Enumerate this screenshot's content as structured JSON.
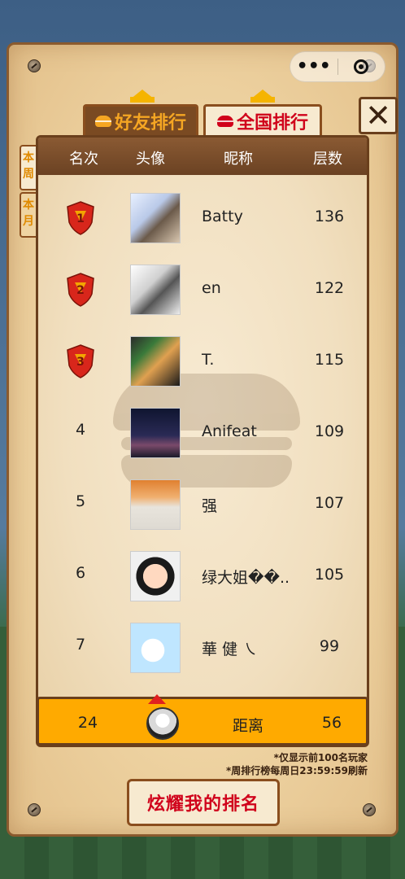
{
  "capsule": {
    "more": "•••"
  },
  "tabs": [
    {
      "label": "好友排行",
      "active": false
    },
    {
      "label": "全国排行",
      "active": true
    }
  ],
  "close": "✕",
  "side_tabs": [
    {
      "label": "本周"
    },
    {
      "label": "本月"
    }
  ],
  "header": {
    "rank": "名次",
    "avatar": "头像",
    "nickname": "昵称",
    "score": "层数"
  },
  "rows": [
    {
      "rank": "1",
      "name": "Batty",
      "score": "136"
    },
    {
      "rank": "2",
      "name": "en",
      "score": "122"
    },
    {
      "rank": "3",
      "name": "T.",
      "score": "115"
    },
    {
      "rank": "4",
      "name": "Anifeat",
      "score": "109"
    },
    {
      "rank": "5",
      "name": "强",
      "score": "107"
    },
    {
      "rank": "6",
      "name": "绿大姐��..",
      "score": "105"
    },
    {
      "rank": "7",
      "name": "華 健 ㇏",
      "score": "99"
    }
  ],
  "me": {
    "rank": "24",
    "label": "距离",
    "score": "56"
  },
  "notes": {
    "line1": "*仅显示前100名玩家",
    "line2": "*周排行榜每周日23:59:59刷新"
  },
  "share_button": "炫耀我的排名",
  "colors": {
    "accent": "#ffaa00",
    "brand_red": "#d0021b",
    "wood": "#6a3f1c"
  }
}
